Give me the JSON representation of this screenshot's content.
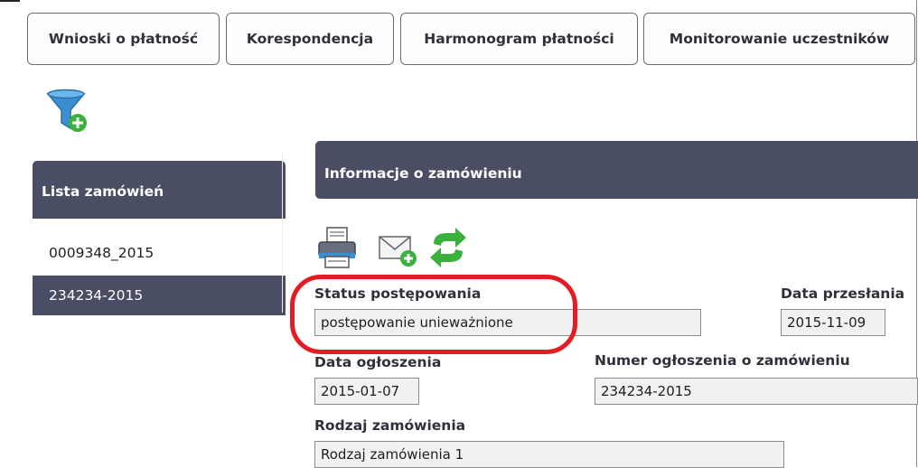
{
  "tabs": [
    {
      "label": "Wnioski o płatność"
    },
    {
      "label": "Korespondencja"
    },
    {
      "label": "Harmonogram płatności"
    },
    {
      "label": "Monitorowanie uczestników"
    }
  ],
  "icons": {
    "filter": "filter-add-icon",
    "print": "printer-icon",
    "mail": "mail-add-icon",
    "refresh": "refresh-icon"
  },
  "sidebar": {
    "header": "Lista zamówień",
    "items": [
      {
        "label": "0009348_2015",
        "selected": false
      },
      {
        "label": "234234-2015",
        "selected": true
      }
    ]
  },
  "main": {
    "header": "Informacje o zamówieniu",
    "fields": {
      "status": {
        "label": "Status postępowania",
        "value": "postępowanie unieważnione"
      },
      "data_przeslania": {
        "label": "Data przesłania",
        "value": "2015-11-09"
      },
      "data_ogloszenia": {
        "label": "Data ogłoszenia",
        "value": "2015-01-07"
      },
      "numer_ogloszenia": {
        "label": "Numer ogłoszenia o zamówieniu",
        "value": "234234-2015"
      },
      "rodzaj": {
        "label": "Rodzaj zamówienia",
        "value": "Rodzaj zamówienia 1"
      }
    }
  },
  "colors": {
    "panel": "#4a4e64",
    "highlight": "#e31b23",
    "accent_green": "#3cb03c",
    "filter_blue": "#3a8fd0"
  }
}
